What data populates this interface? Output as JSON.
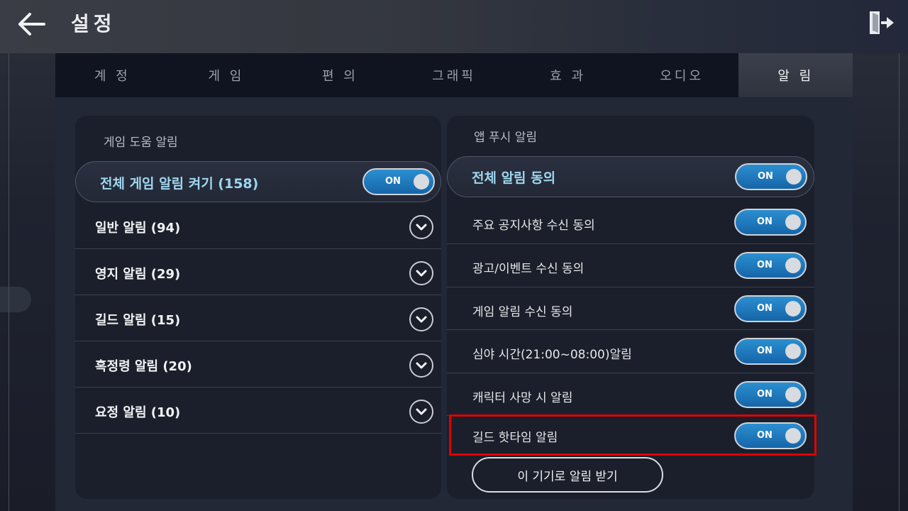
{
  "header": {
    "title": "설정"
  },
  "tabs": [
    {
      "label": "계 정"
    },
    {
      "label": "게 임"
    },
    {
      "label": "편 의"
    },
    {
      "label": "그래픽"
    },
    {
      "label": "효 과"
    },
    {
      "label": "오디오"
    },
    {
      "label": "알 림"
    }
  ],
  "active_tab": "알 림",
  "left_panel": {
    "title": "게임 도움 알림",
    "master": {
      "label": "전체 게임 알림 켜기 (158)",
      "toggle": "ON"
    },
    "items": [
      {
        "label": "일반 알림 (94)"
      },
      {
        "label": "영지 알림 (29)"
      },
      {
        "label": "길드 알림 (15)"
      },
      {
        "label": "흑정령 알림 (20)"
      },
      {
        "label": "요정 알림 (10)"
      }
    ]
  },
  "right_panel": {
    "title": "앱 푸시 알림",
    "master": {
      "label": "전체 알림 동의",
      "toggle": "ON"
    },
    "items": [
      {
        "label": "주요 공지사항 수신 동의",
        "toggle": "ON"
      },
      {
        "label": "광고/이벤트 수신 동의",
        "toggle": "ON"
      },
      {
        "label": "게임 알림 수신 동의",
        "toggle": "ON"
      },
      {
        "label": "심야 시간(21:00~08:00)알림",
        "toggle": "ON"
      },
      {
        "label": "캐릭터 사망 시 알림",
        "toggle": "ON"
      },
      {
        "label": "길드 핫타임 알림",
        "toggle": "ON"
      }
    ],
    "device_button": "이 기기로 알림 받기"
  },
  "colors": {
    "toggle_on": "#1f7fc4",
    "highlight": "#e00000",
    "master_label": "#9fd6ee"
  }
}
